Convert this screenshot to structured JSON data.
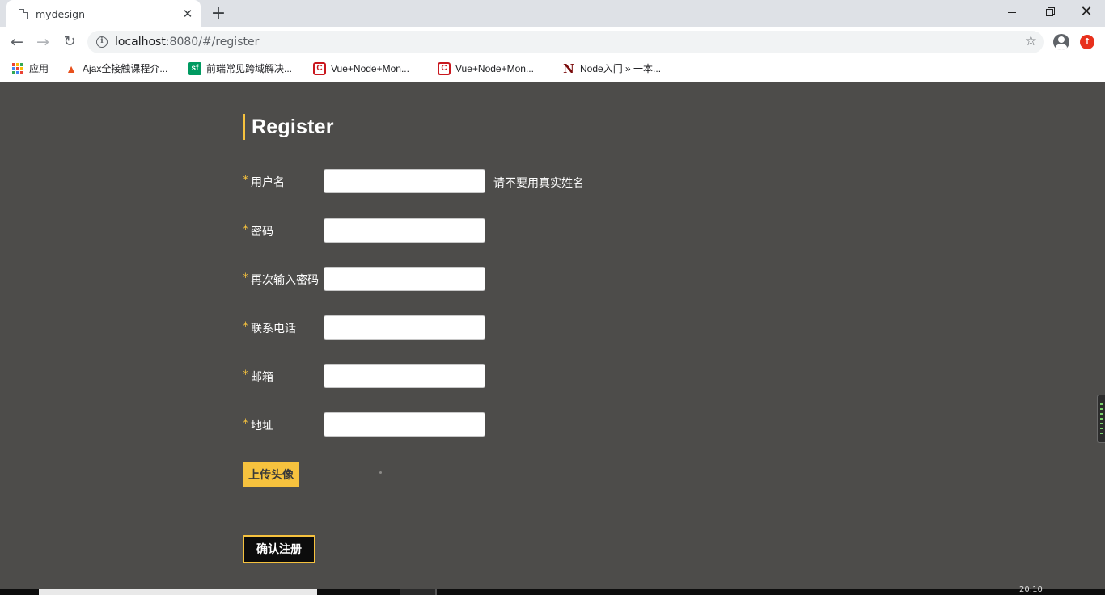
{
  "browser": {
    "tab_title": "mydesign",
    "tab_close": "✕",
    "new_tab": "+",
    "url_host": "localhost",
    "url_rest": ":8080/#/register",
    "win_close": "✕"
  },
  "bookmarks": [
    {
      "label": "应用",
      "icon": "apps-grid-icon"
    },
    {
      "label": "Ajax全接触课程介...",
      "icon": "fire-icon"
    },
    {
      "label": "前端常见跨域解决...",
      "icon": "sf-icon"
    },
    {
      "label": "Vue+Node+Mon...",
      "icon": "csdn-icon"
    },
    {
      "label": "Vue+Node+Mon...",
      "icon": "csdn-icon"
    },
    {
      "label": "Node入门 » 一本...",
      "icon": "node-n-icon"
    }
  ],
  "bookmark_icons": {
    "sf": "sf",
    "csdn": "C",
    "node": "N"
  },
  "page": {
    "title": "Register",
    "required_mark": "*",
    "fields": [
      {
        "label": "用户名",
        "value": "",
        "hint": "请不要用真实姓名"
      },
      {
        "label": "密码",
        "value": ""
      },
      {
        "label": "再次输入密码",
        "value": ""
      },
      {
        "label": "联系电话",
        "value": ""
      },
      {
        "label": "邮箱",
        "value": ""
      },
      {
        "label": "地址",
        "value": ""
      }
    ],
    "upload_label": "上传头像",
    "submit_label": "确认注册"
  },
  "colors": {
    "page_background": "#4d4c4a",
    "accent": "#f6c23e",
    "submit_background": "#0c0c0c"
  },
  "taskbar": {
    "clock": "20:10"
  }
}
